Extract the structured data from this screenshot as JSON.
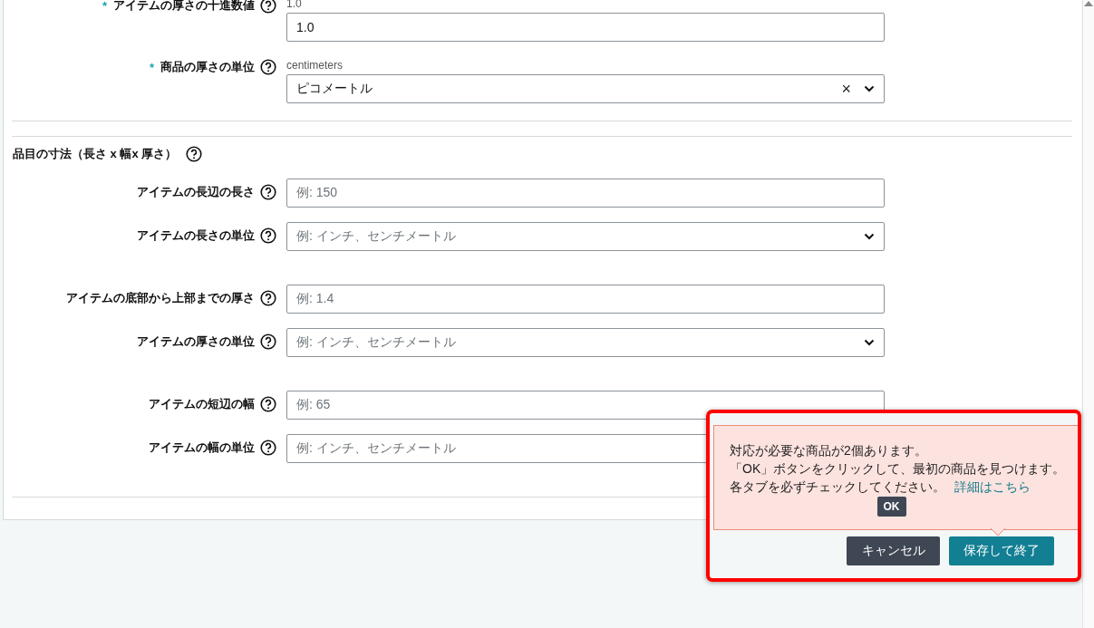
{
  "top_fields": [
    {
      "marker": "*",
      "label": "アイテムの厚さの十進数値",
      "hint": "1.0",
      "value": "1.0",
      "kind": "input"
    },
    {
      "marker": "*",
      "label": "商品の厚さの単位",
      "hint": "centimeters",
      "value": "ピコメートル",
      "kind": "select",
      "clear": "×"
    }
  ],
  "section": {
    "title": "品目の寸法（長さ x 幅x 厚さ）"
  },
  "groups": [
    {
      "fields": [
        {
          "label": "アイテムの長辺の長さ",
          "placeholder": "例: 150",
          "kind": "input"
        },
        {
          "label": "アイテムの長さの単位",
          "placeholder": "例: インチ、センチメートル",
          "kind": "select"
        }
      ]
    },
    {
      "fields": [
        {
          "label": "アイテムの底部から上部までの厚さ",
          "placeholder": "例: 1.4",
          "kind": "input"
        },
        {
          "label": "アイテムの厚さの単位",
          "placeholder": "例: インチ、センチメートル",
          "kind": "select"
        }
      ]
    },
    {
      "fields": [
        {
          "label": "アイテムの短辺の幅",
          "placeholder": "例: 65",
          "kind": "input"
        },
        {
          "label": "アイテムの幅の単位",
          "placeholder": "例: インチ、センチメートル",
          "kind": "select"
        }
      ]
    }
  ],
  "alert": {
    "lines": [
      "対応が必要な商品が2個あります。",
      "「OK」ボタンをクリックして、最初の商品を見つけます。"
    ],
    "last_line": "各タブを必ずチェックしてください。",
    "link": "詳細はこちら",
    "ok": "OK"
  },
  "buttons": [
    {
      "label": "キャンセル",
      "kind": "secondary"
    },
    {
      "label": "保存して終了",
      "kind": "primary"
    }
  ]
}
